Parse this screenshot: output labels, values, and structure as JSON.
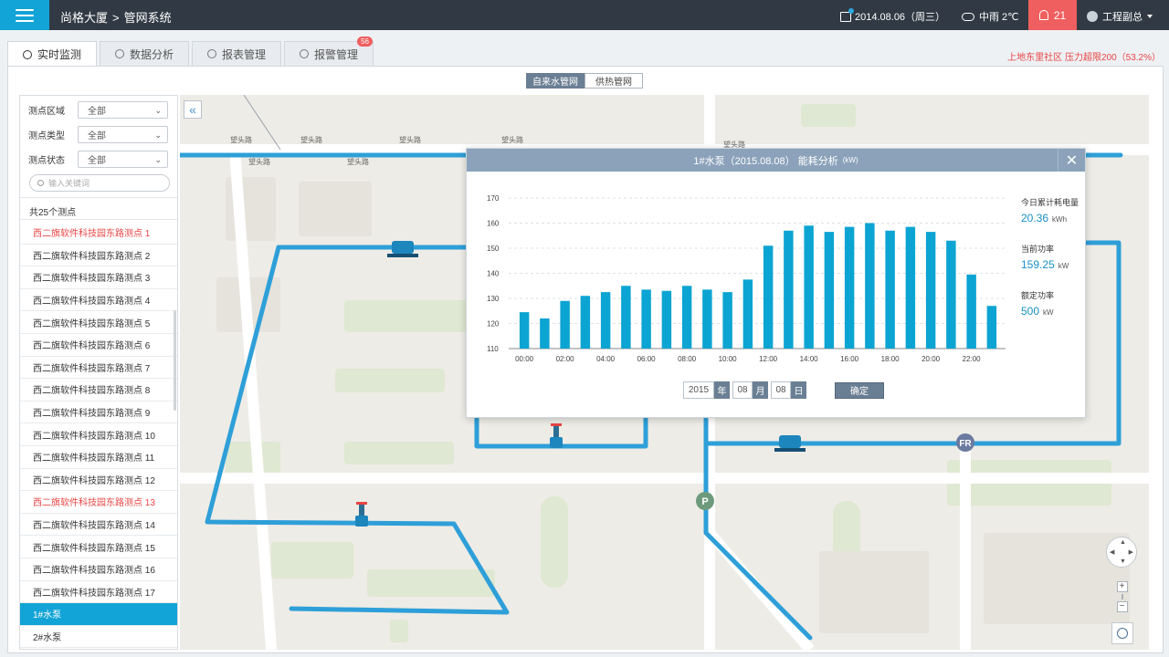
{
  "header": {
    "building": "尚格大厦",
    "separator": ">",
    "system": "管网系统",
    "date": "2014.08.06（周三）",
    "weather": "中雨  2℃",
    "alarm_count": "21",
    "user": "工程副总",
    "colors": {
      "bar": "#313a44",
      "accent": "#12a4d6",
      "alarm": "#ef5f5f"
    }
  },
  "tabs": [
    {
      "label": "实时监测",
      "icon": "monitor-icon",
      "active": true
    },
    {
      "label": "数据分析",
      "icon": "bar-chart-icon",
      "active": false
    },
    {
      "label": "报表管理",
      "icon": "report-icon",
      "active": false
    },
    {
      "label": "报警管理",
      "icon": "alarm-icon",
      "active": false,
      "badge": "56"
    }
  ],
  "alert_notice": "上地东里社区 压力超限200（53.2%）",
  "network_switch": {
    "options": [
      "自来水管网",
      "供热管网"
    ],
    "selected": "自来水管网"
  },
  "filters": [
    {
      "label": "测点区域",
      "value": "全部"
    },
    {
      "label": "测点类型",
      "value": "全部"
    },
    {
      "label": "测点状态",
      "value": "全部"
    }
  ],
  "search": {
    "placeholder": "输入关键词"
  },
  "list": {
    "count_label": "共25个测点",
    "items": [
      {
        "label": "西二旗软件科技园东路测点 1",
        "state": "alarm"
      },
      {
        "label": "西二旗软件科技园东路测点 2",
        "state": "normal"
      },
      {
        "label": "西二旗软件科技园东路测点 3",
        "state": "normal"
      },
      {
        "label": "西二旗软件科技园东路测点 4",
        "state": "normal"
      },
      {
        "label": "西二旗软件科技园东路测点 5",
        "state": "normal"
      },
      {
        "label": "西二旗软件科技园东路测点 6",
        "state": "normal"
      },
      {
        "label": "西二旗软件科技园东路测点 7",
        "state": "normal"
      },
      {
        "label": "西二旗软件科技园东路测点 8",
        "state": "normal"
      },
      {
        "label": "西二旗软件科技园东路测点 9",
        "state": "normal"
      },
      {
        "label": "西二旗软件科技园东路测点 10",
        "state": "normal"
      },
      {
        "label": "西二旗软件科技园东路测点 11",
        "state": "normal"
      },
      {
        "label": "西二旗软件科技园东路测点 12",
        "state": "normal"
      },
      {
        "label": "西二旗软件科技园东路测点 13",
        "state": "alarm"
      },
      {
        "label": "西二旗软件科技园东路测点 14",
        "state": "normal"
      },
      {
        "label": "西二旗软件科技园东路测点 15",
        "state": "normal"
      },
      {
        "label": "西二旗软件科技园东路测点 16",
        "state": "normal"
      },
      {
        "label": "西二旗软件科技园东路测点 17",
        "state": "normal"
      },
      {
        "label": "1#水泵",
        "state": "selected"
      },
      {
        "label": "2#水泵",
        "state": "normal"
      }
    ]
  },
  "map": {
    "road_labels": [
      "望头路",
      "望头路",
      "望头路",
      "望头路",
      "望头路",
      "望头路",
      "望头路"
    ],
    "markers": [
      {
        "label": "P"
      },
      {
        "label": "FR"
      }
    ],
    "colors": {
      "pipe": "#2e9fd8",
      "ground": "#eeece6",
      "block": "#dfe8d2"
    }
  },
  "popup": {
    "title": "1#水泵（2015.08.08）  能耗分析",
    "title_unit": "(kW)",
    "stats": [
      {
        "label": "今日累计耗电量",
        "value": "20.36",
        "unit": "kWh"
      },
      {
        "label": "当前功率",
        "value": "159.25",
        "unit": "kW"
      },
      {
        "label": "额定功率",
        "value": "500",
        "unit": "kW"
      }
    ],
    "date_picker": {
      "year": "2015",
      "year_unit": "年",
      "month": "08",
      "month_unit": "月",
      "day": "08",
      "day_unit": "日",
      "confirm": "确定"
    }
  },
  "chart_data": {
    "type": "bar",
    "title": "",
    "xlabel": "",
    "ylabel": "",
    "ylim": [
      110,
      170
    ],
    "yticks": [
      110,
      120,
      130,
      140,
      150,
      160,
      170
    ],
    "xticks": [
      "00:00",
      "02:00",
      "04:00",
      "06:00",
      "08:00",
      "10:00",
      "12:00",
      "14:00",
      "16:00",
      "18:00",
      "20:00",
      "22:00"
    ],
    "categories": [
      "00:00",
      "01:00",
      "02:00",
      "03:00",
      "04:00",
      "05:00",
      "06:00",
      "07:00",
      "08:00",
      "09:00",
      "10:00",
      "11:00",
      "12:00",
      "13:00",
      "14:00",
      "15:00",
      "16:00",
      "17:00",
      "18:00",
      "19:00",
      "20:00",
      "21:00",
      "22:00",
      "23:00"
    ],
    "values": [
      124.5,
      122,
      129,
      131,
      132.5,
      135,
      133.5,
      133,
      135,
      133.5,
      132.5,
      137.5,
      151,
      157,
      159,
      156.5,
      158.5,
      160,
      157,
      158.5,
      156.5,
      153,
      139.5,
      127
    ],
    "grid": true,
    "color": "#0ca4d2"
  },
  "map_controls": {
    "zoom_in": "+",
    "zoom_out": "−"
  }
}
